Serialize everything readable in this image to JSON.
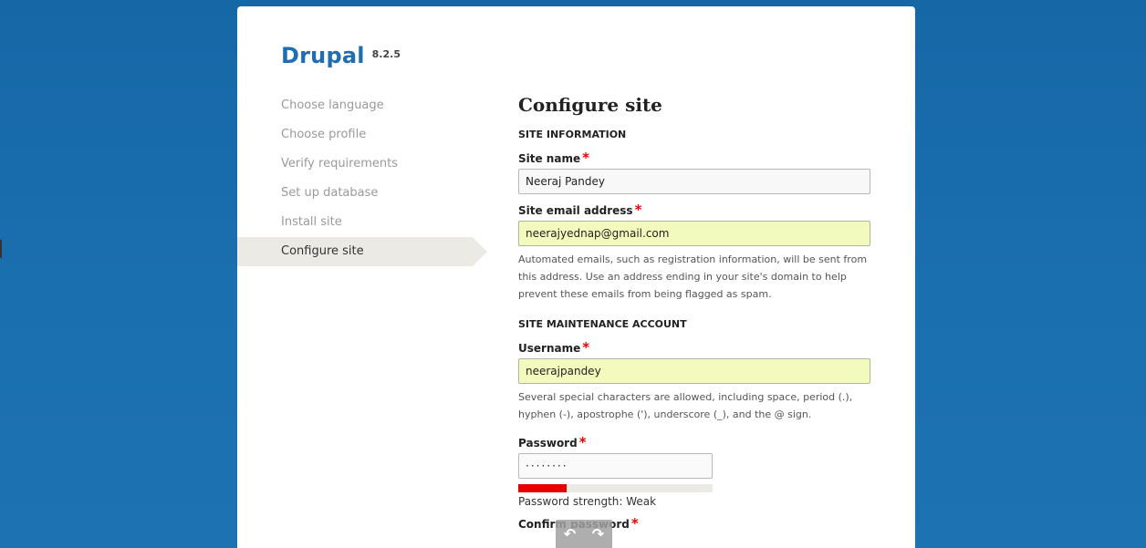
{
  "brand": {
    "name": "Drupal",
    "version": "8.2.5"
  },
  "steps": [
    {
      "label": "Choose language",
      "active": false
    },
    {
      "label": "Choose profile",
      "active": false
    },
    {
      "label": "Verify requirements",
      "active": false
    },
    {
      "label": "Set up database",
      "active": false
    },
    {
      "label": "Install site",
      "active": false
    },
    {
      "label": "Configure site",
      "active": true
    }
  ],
  "main": {
    "title": "Configure site",
    "site_information": {
      "section_title": "SITE INFORMATION",
      "site_name": {
        "label": "Site name",
        "required_mark": "*",
        "value": "Neeraj Pandey"
      },
      "site_email": {
        "label": "Site email address",
        "required_mark": "*",
        "value": "neerajyednap@gmail.com",
        "description": "Automated emails, such as registration information, will be sent from this address. Use an address ending in your site's domain to help prevent these emails from being flagged as spam."
      }
    },
    "maintenance_account": {
      "section_title": "SITE MAINTENANCE ACCOUNT",
      "username": {
        "label": "Username",
        "required_mark": "*",
        "value": "neerajpandey",
        "description": "Several special characters are allowed, including space, period (.), hyphen (-), apostrophe ('), underscore (_), and the @ sign."
      },
      "password": {
        "label": "Password",
        "required_mark": "*",
        "value": "········",
        "strength_text": "Password strength: Weak",
        "strength_level": 0.25
      },
      "confirm_password": {
        "label": "Confirm password",
        "required_mark": "*"
      }
    }
  },
  "overlay": {
    "undo_icon": "↶",
    "redo_icon": "↷"
  },
  "colors": {
    "background": "#1a6fae",
    "brand": "#1f6db3",
    "required": "#e00000",
    "autofill": "#f2fbbd",
    "strength_weak": "#e80000"
  }
}
